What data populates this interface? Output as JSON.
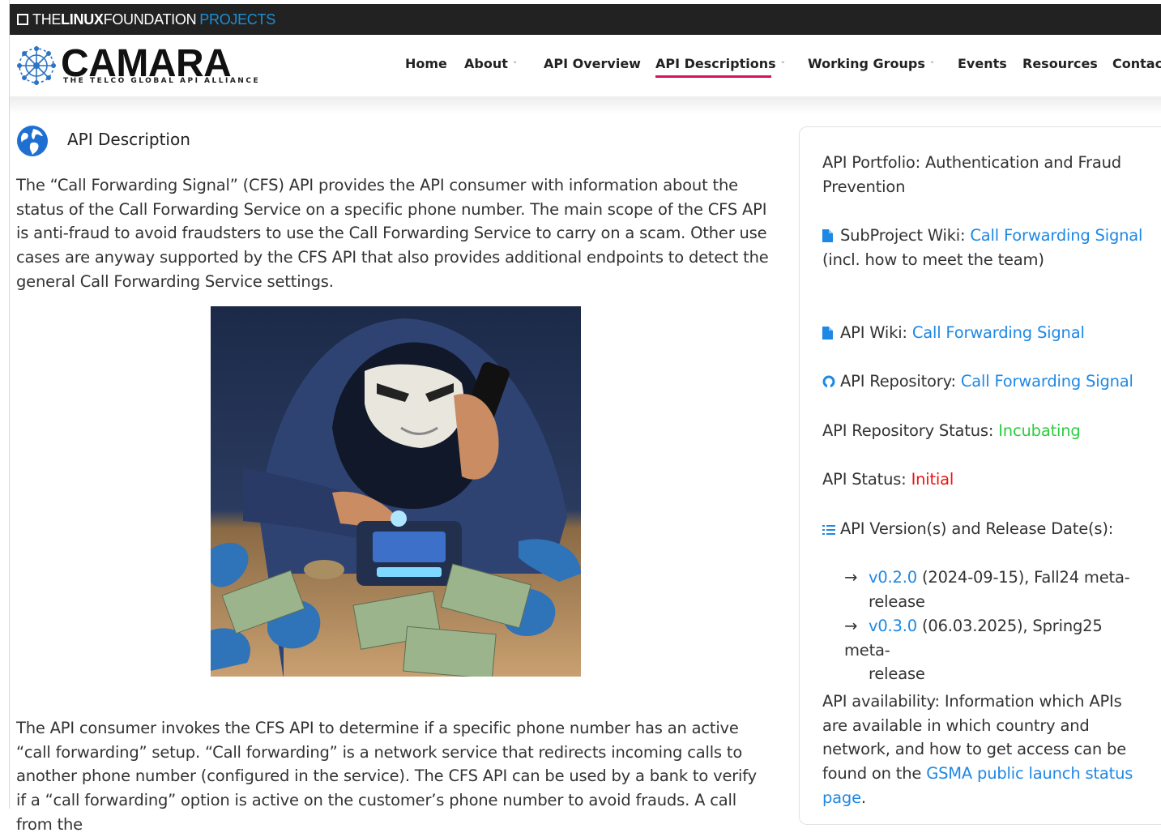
{
  "lf_bar": {
    "the": "THE",
    "linux": "LINUX",
    "foundation": "FOUNDATION",
    "projects": "PROJECTS"
  },
  "logo": {
    "word": "CAMARA",
    "tagline": "THE TELCO GLOBAL API ALLIANCE"
  },
  "nav": {
    "items": [
      {
        "label": "Home"
      },
      {
        "label": "About",
        "chevron": "˅"
      },
      {
        "label": "API Overview"
      },
      {
        "label": "API Descriptions",
        "chevron": "˅",
        "active": true
      },
      {
        "label": "Working Groups",
        "chevron": "˅"
      },
      {
        "label": "Events"
      },
      {
        "label": "Resources"
      },
      {
        "label": "Contac"
      }
    ]
  },
  "main": {
    "title": "API Description",
    "intro": "The “Call Forwarding Signal” (CFS) API provides the API consumer with information about the status of the Call Forwarding Service on a specific phone number. The main scope of the CFS API is anti-fraud to avoid fraudsters to use the Call Forwarding Service to carry on a scam. Other use cases are anyway supported by the CFS API that also provides additional endpoints to detect the general Call Forwarding Service settings.",
    "body": "The API consumer invokes the CFS API to determine if a specific phone number has an active “call forwarding” setup. “Call forwarding” is a network service that redirects incoming calls to another phone number (configured in the service). The CFS API can be used by a bank to verify if a “call forwarding” option is active on the customer’s phone number to avoid frauds. A call from the"
  },
  "sidebar": {
    "portfolio": "API Portfolio: Authentication and Fraud Prevention",
    "subproject_label": "SubProject Wiki: ",
    "subproject_link": "Call Forwarding Signal",
    "subproject_note": "(incl. how to meet the team)",
    "wiki_label": "API Wiki: ",
    "wiki_link": "Call Forwarding Signal",
    "repo_label": "API Repository: ",
    "repo_link": "Call Forwarding Signal",
    "repo_status_label": "API Repository Status: ",
    "repo_status_value": "Incubating",
    "status_label": "API Status: ",
    "status_value": "Initial",
    "versions_label": "API Version(s) and Release Date(s):",
    "releases": [
      {
        "arrow": "→",
        "version": "v0.2.0",
        "rest": " (2024-09-15), Fall24 meta-",
        "cont": "release"
      },
      {
        "arrow": "→",
        "version": "v0.3.0",
        "rest": " (06.03.2025), Spring25 meta-",
        "cont": "release"
      }
    ],
    "availability_text": "API availability: Information which APIs are available in which country and network, and how to get access can be found on the ",
    "availability_link": "GSMA public launch status page",
    "availability_end": "."
  },
  "colors": {
    "accent": "#d4145a",
    "link": "#1e88e5",
    "incubating": "#2ecc40",
    "initial": "#ee1111"
  },
  "icons": [
    "globe-icon",
    "document-icon",
    "github-icon",
    "list-icon",
    "camara-logo-mark"
  ]
}
